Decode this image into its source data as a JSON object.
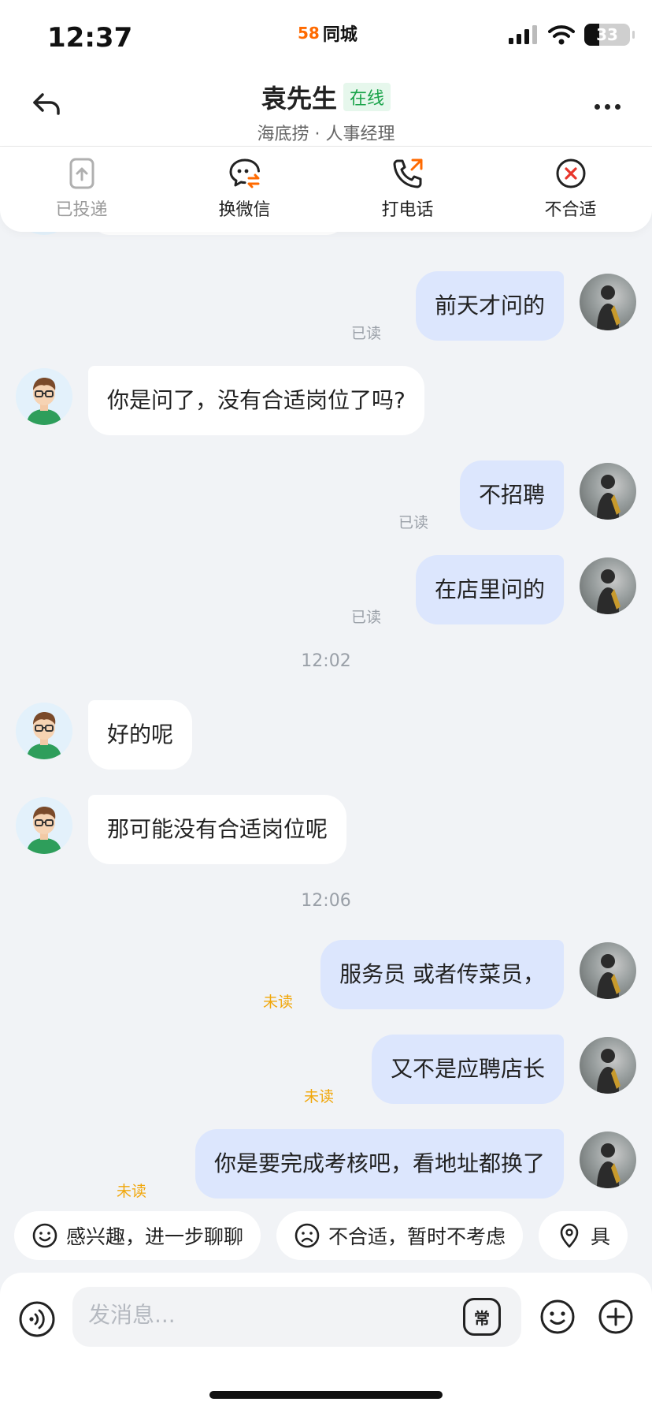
{
  "status_bar": {
    "time": "12:37",
    "brand_logo": "58",
    "brand_name": "同城",
    "battery_level": "33"
  },
  "header": {
    "contact_name": "袁先生",
    "online_badge": "在线",
    "subtitle": "海底捞 · 人事经理"
  },
  "actions": [
    {
      "label": "已投递",
      "icon": "resume-sent-icon",
      "state": "disabled"
    },
    {
      "label": "换微信",
      "icon": "wechat-exchange-icon"
    },
    {
      "label": "打电话",
      "icon": "phone-call-icon"
    },
    {
      "label": "不合适",
      "icon": "reject-icon"
    }
  ],
  "messages": [
    {
      "from": "me",
      "text": "前天才问的",
      "status": "已读"
    },
    {
      "from": "them",
      "text": "你是问了，没有合适岗位了吗?"
    },
    {
      "from": "me",
      "text": "不招聘",
      "status": "已读"
    },
    {
      "from": "me",
      "text": "在店里问的",
      "status": "已读"
    },
    {
      "type": "time",
      "text": "12:02"
    },
    {
      "from": "them",
      "text": "好的呢"
    },
    {
      "from": "them",
      "text": "那可能没有合适岗位呢"
    },
    {
      "type": "time",
      "text": "12:06"
    },
    {
      "from": "me",
      "text": "服务员 或者传菜员，",
      "status": "未读"
    },
    {
      "from": "me",
      "text": "又不是应聘店长",
      "status": "未读"
    },
    {
      "from": "me",
      "text": "你是要完成考核吧，看地址都换了",
      "status": "未读"
    }
  ],
  "quick_replies": [
    {
      "label": "感兴趣，进一步聊聊",
      "icon": "smile-icon"
    },
    {
      "label": "不合适，暂时不考虑",
      "icon": "sad-icon"
    },
    {
      "label": "具",
      "icon": "location-icon"
    }
  ],
  "input": {
    "placeholder": "发消息...",
    "phrase_button": "常"
  },
  "colors": {
    "my_bubble": "#dce6fd",
    "their_bubble": "#ffffff",
    "unread": "#f1a70b",
    "read": "#9aa0a8",
    "online_green": "#1aa34a",
    "reject_red": "#e8352b",
    "accent_orange": "#ff6a00"
  }
}
